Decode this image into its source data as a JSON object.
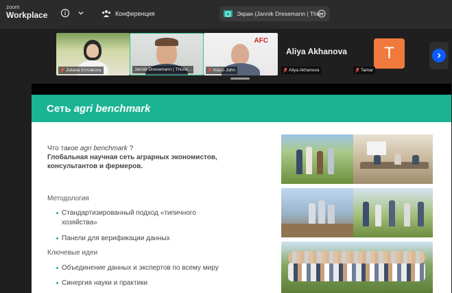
{
  "app": {
    "brand_small": "zoom",
    "brand_big": "Workplace"
  },
  "topbar": {
    "meeting_name": "Конференция",
    "share_label": "Экран (Jannik Dresemann | Thün",
    "icons": [
      "info-icon",
      "chevron-down-icon",
      "meeting-icon",
      "screen-share-icon",
      "more-icon"
    ]
  },
  "participants": [
    {
      "label": "Juliana Ermakova",
      "muted": true,
      "kind": "video"
    },
    {
      "label": "Jannik Dresemann | Thüne...",
      "muted": false,
      "kind": "video",
      "active": true
    },
    {
      "label": "Klaus John",
      "muted": true,
      "kind": "video",
      "logo_text": "AFC"
    },
    {
      "label": "Aliya Akhanova",
      "display_name": "Aliya Akhanova",
      "muted": true,
      "kind": "name"
    },
    {
      "label": "Tamar",
      "avatar_letter": "T",
      "muted": true,
      "kind": "avatar"
    }
  ],
  "colors": {
    "accent": "#1ab394",
    "zoom_blue": "#0b5cff",
    "avatar": "#f07a3c",
    "active_border": "#35c08a"
  },
  "slide": {
    "title_prefix": "Сеть ",
    "title_italic": "agri benchmark",
    "question_prefix": "Что такое ",
    "question_italic": "agri benchmark",
    "question_suffix": " ?",
    "question_body_1": "Глобальная научная сеть аграрных экономистов,",
    "question_body_2": "консультантов и фермеров.",
    "section_1": "Методология",
    "section_1_items": [
      "Стандартизированный подход «типичного",
      "хозяйства»",
      "Панели для верификации данных"
    ],
    "section_2": "Ключевые идеи",
    "section_2_items": [
      "Объединение данных и экспертов по всему миру",
      "Синергия науки и практики"
    ]
  }
}
